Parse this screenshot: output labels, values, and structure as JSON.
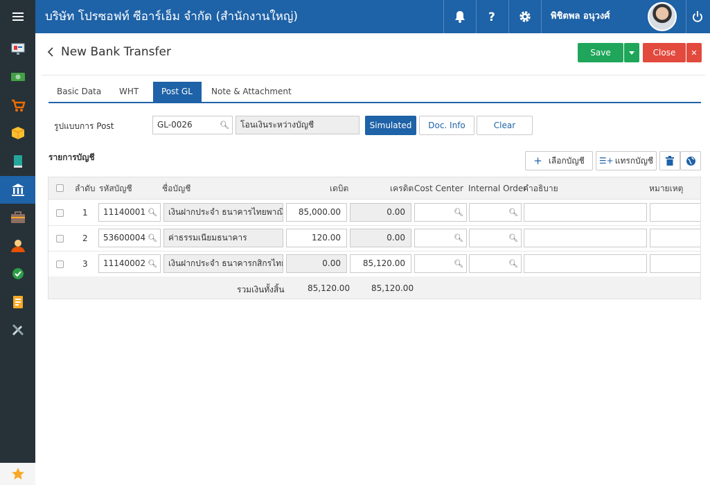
{
  "app": {
    "company": "บริษัท โปรซอฟท์ ซีอาร์เอ็ม จำกัด (สำนักงานใหญ่)",
    "user": "พิชิตพล อนุวงศ์"
  },
  "page": {
    "title": "New Bank Transfer",
    "save_label": "Save",
    "close_label": "Close"
  },
  "tabs": [
    "Basic Data",
    "WHT",
    "Post GL",
    "Note & Attachment"
  ],
  "post": {
    "label": "รูปแบบการ Post",
    "code": "GL-0026",
    "name": "โอนเงินระหว่างบัญชี",
    "simulated_label": "Simulated",
    "docinfo_label": "Doc. Info",
    "clear_label": "Clear"
  },
  "accounts": {
    "section_title": "รายการบัญชี",
    "select_label": "เลือกบัญชี",
    "insert_label": "แทรกบัญชี",
    "columns": {
      "no": "ลำดับ",
      "code": "รหัสบัญชี",
      "name": "ชื่อบัญชี",
      "debit": "เดบิต",
      "credit": "เครดิต",
      "cost_center": "Cost Center",
      "internal_order": "Internal Order",
      "description": "คำอธิบาย",
      "remark": "หมายเหตุ"
    },
    "rows": [
      {
        "no": "1",
        "code": "11140001",
        "name": "เงินฝากประจำ ธนาคารไทยพาณิชย์",
        "debit": "85,000.00",
        "credit": "0.00"
      },
      {
        "no": "2",
        "code": "53600004",
        "name": "ค่าธรรมเนียมธนาคาร",
        "debit": "120.00",
        "credit": "0.00"
      },
      {
        "no": "3",
        "code": "11140002",
        "name": "เงินฝากประจำ ธนาคารกสิกรไทย",
        "debit": "0.00",
        "credit": "85,120.00"
      }
    ],
    "total_label": "รวมเงินทั้งสิ้น",
    "total_debit": "85,120.00",
    "total_credit": "85,120.00"
  },
  "colors": {
    "primary": "#1e62a7",
    "save": "#1fa65a",
    "close": "#e24a3d",
    "sidebar": "#263238"
  },
  "icons": [
    "menu-icon",
    "monitor-icon",
    "cash-icon",
    "cart-icon",
    "box-icon",
    "book-icon",
    "bank-icon",
    "briefcase-icon",
    "people-icon",
    "check-circle-icon",
    "report-icon",
    "tools-icon",
    "star-icon",
    "bell-icon",
    "help-icon",
    "gear-icon",
    "power-icon",
    "search-icon",
    "plus-icon",
    "trash-icon",
    "globe-icon"
  ]
}
